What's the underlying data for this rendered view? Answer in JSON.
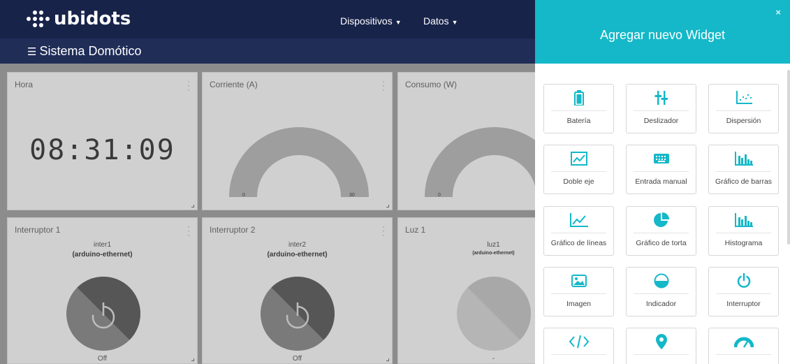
{
  "header": {
    "logo_text": "ubidots",
    "nav": [
      {
        "label": "Dispositivos"
      },
      {
        "label": "Datos"
      }
    ],
    "dashboard_title": "Sistema Domótico"
  },
  "widgets": {
    "hora": {
      "title": "Hora",
      "value": "08:31:09"
    },
    "corriente": {
      "title": "Corriente (A)",
      "min": "0",
      "max": "30"
    },
    "consumo": {
      "title": "Consumo (W)",
      "min": "0"
    },
    "interruptor1": {
      "title": "Interruptor 1",
      "variable": "inter1",
      "device": "(arduino-ethernet)",
      "state": "Off"
    },
    "interruptor2": {
      "title": "Interruptor 2",
      "variable": "inter2",
      "device": "(arduino-ethernet)",
      "state": "Off"
    },
    "luz1": {
      "title": "Luz 1",
      "variable": "luz1",
      "device": "(arduino-ethernet)",
      "state": "-"
    }
  },
  "panel": {
    "title": "Agregar nuevo Widget",
    "close": "×",
    "accent_color": "#14b8c8",
    "items": [
      {
        "label": "Batería",
        "icon": "battery-icon"
      },
      {
        "label": "Deslizador",
        "icon": "slider-icon"
      },
      {
        "label": "Dispersión",
        "icon": "scatter-icon"
      },
      {
        "label": "Doble eje",
        "icon": "double-axis-icon"
      },
      {
        "label": "Entrada manual",
        "icon": "keyboard-icon"
      },
      {
        "label": "Gráfico de barras",
        "icon": "bar-chart-icon"
      },
      {
        "label": "Gráfico de líneas",
        "icon": "line-chart-icon"
      },
      {
        "label": "Gráfico de torta",
        "icon": "pie-chart-icon"
      },
      {
        "label": "Histograma",
        "icon": "histogram-icon"
      },
      {
        "label": "Imagen",
        "icon": "image-icon"
      },
      {
        "label": "Indicador",
        "icon": "indicator-icon"
      },
      {
        "label": "Interruptor",
        "icon": "power-icon"
      },
      {
        "label": "",
        "icon": "code-icon"
      },
      {
        "label": "",
        "icon": "map-pin-icon"
      },
      {
        "label": "",
        "icon": "gauge-icon"
      }
    ]
  }
}
